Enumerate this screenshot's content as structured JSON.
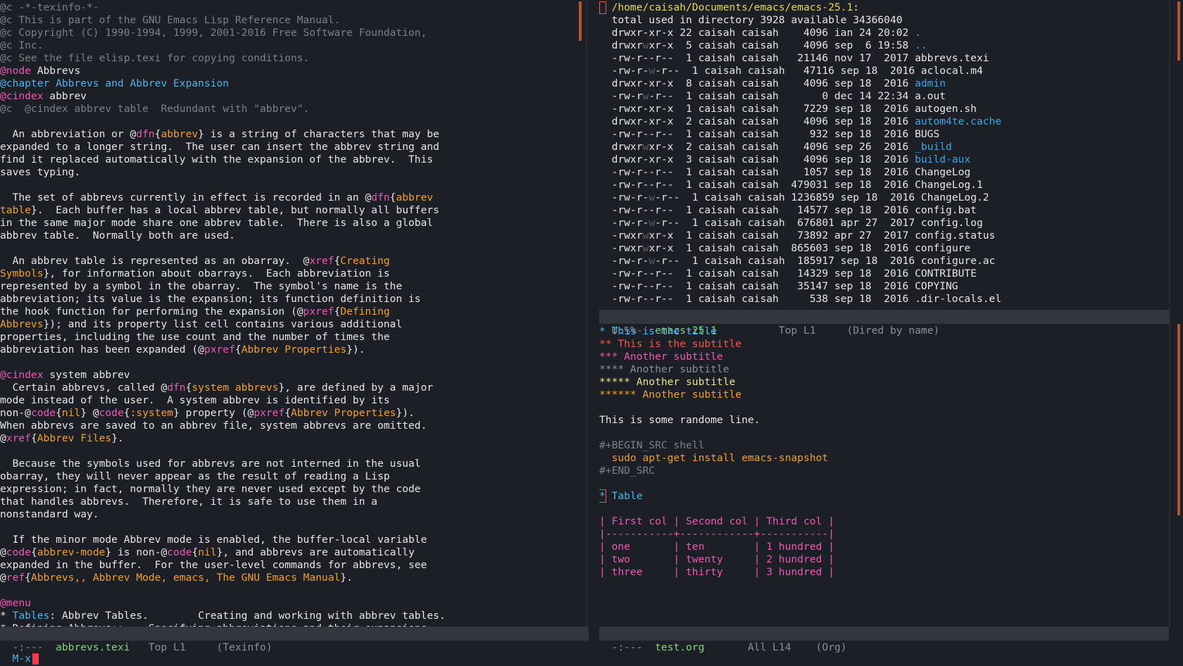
{
  "left": {
    "lines": [
      [
        [
          "@c",
          "c-comment"
        ],
        [
          " -*-texinfo-*-",
          "c-comment"
        ]
      ],
      [
        [
          "@c This is part of the GNU Emacs Lisp Reference Manual.",
          "c-comment"
        ]
      ],
      [
        [
          "@c Copyright (C) 1990-1994, 1999, 2001-2016 Free Software Foundation,",
          "c-comment"
        ]
      ],
      [
        [
          "@c Inc.",
          "c-comment"
        ]
      ],
      [
        [
          "@c See the file elisp.texi for copying conditions.",
          "c-comment"
        ]
      ],
      [
        [
          "@node",
          "c-kw"
        ],
        [
          " Abbrevs",
          "c-plain"
        ]
      ],
      [
        [
          "@chapter Abbrevs and Abbrev Expansion",
          "c-link"
        ]
      ],
      [
        [
          "@cindex",
          "c-kw"
        ],
        [
          " abbrev",
          "c-plain"
        ]
      ],
      [
        [
          "@c  @cindex abbrev table  Redundant with \"abbrev\".",
          "c-comment"
        ]
      ],
      [
        [
          "",
          ""
        ]
      ],
      [
        [
          "  An abbreviation or @",
          "c-plain"
        ],
        [
          "dfn",
          "c-kw"
        ],
        [
          "{",
          "c-plain"
        ],
        [
          "abbrev",
          "c-arg"
        ],
        [
          "} is a string of characters that may be",
          "c-plain"
        ]
      ],
      [
        [
          "expanded to a longer string.  The user can insert the abbrev string and",
          "c-plain"
        ]
      ],
      [
        [
          "find it replaced automatically with the expansion of the abbrev.  This",
          "c-plain"
        ]
      ],
      [
        [
          "saves typing.",
          "c-plain"
        ]
      ],
      [
        [
          "",
          ""
        ]
      ],
      [
        [
          "  The set of abbrevs currently in effect is recorded in an @",
          "c-plain"
        ],
        [
          "dfn",
          "c-kw"
        ],
        [
          "{",
          "c-plain"
        ],
        [
          "abbrev",
          "c-arg"
        ]
      ],
      [
        [
          "table",
          "c-arg"
        ],
        [
          "}.  Each buffer has a local abbrev table, but normally all buffers",
          "c-plain"
        ]
      ],
      [
        [
          "in the same major mode share one abbrev table.  There is also a global",
          "c-plain"
        ]
      ],
      [
        [
          "abbrev table.  Normally both are used.",
          "c-plain"
        ]
      ],
      [
        [
          "",
          ""
        ]
      ],
      [
        [
          "  An abbrev table is represented as an obarray.  @",
          "c-plain"
        ],
        [
          "xref",
          "c-kw"
        ],
        [
          "{",
          "c-plain"
        ],
        [
          "Creating",
          "c-arg"
        ]
      ],
      [
        [
          "Symbols",
          "c-arg"
        ],
        [
          "}, for information about obarrays.  Each abbreviation is",
          "c-plain"
        ]
      ],
      [
        [
          "represented by a symbol in the obarray.  The symbol's name is the",
          "c-plain"
        ]
      ],
      [
        [
          "abbreviation; its value is the expansion; its function definition is",
          "c-plain"
        ]
      ],
      [
        [
          "the hook function for performing the expansion (@",
          "c-plain"
        ],
        [
          "pxref",
          "c-kw"
        ],
        [
          "{",
          "c-plain"
        ],
        [
          "Defining",
          "c-arg"
        ]
      ],
      [
        [
          "Abbrevs",
          "c-arg"
        ],
        [
          "}); and its property list cell contains various additional",
          "c-plain"
        ]
      ],
      [
        [
          "properties, including the use count and the number of times the",
          "c-plain"
        ]
      ],
      [
        [
          "abbreviation has been expanded (@",
          "c-plain"
        ],
        [
          "pxref",
          "c-kw"
        ],
        [
          "{",
          "c-plain"
        ],
        [
          "Abbrev Properties",
          "c-arg"
        ],
        [
          "}).",
          "c-plain"
        ]
      ],
      [
        [
          "",
          ""
        ]
      ],
      [
        [
          "@cindex",
          "c-kw"
        ],
        [
          " system abbrev",
          "c-plain"
        ]
      ],
      [
        [
          "  Certain abbrevs, called @",
          "c-plain"
        ],
        [
          "dfn",
          "c-kw"
        ],
        [
          "{",
          "c-plain"
        ],
        [
          "system abbrevs",
          "c-arg"
        ],
        [
          "}, are defined by a major",
          "c-plain"
        ]
      ],
      [
        [
          "mode instead of the user.  A system abbrev is identified by its",
          "c-plain"
        ]
      ],
      [
        [
          "non-@",
          "c-plain"
        ],
        [
          "code",
          "c-kw"
        ],
        [
          "{",
          "c-plain"
        ],
        [
          "nil",
          "c-arg"
        ],
        [
          "} @",
          "c-plain"
        ],
        [
          "code",
          "c-kw"
        ],
        [
          "{",
          "c-plain"
        ],
        [
          ":system",
          "c-arg"
        ],
        [
          "} property (@",
          "c-plain"
        ],
        [
          "pxref",
          "c-kw"
        ],
        [
          "{",
          "c-plain"
        ],
        [
          "Abbrev Properties",
          "c-arg"
        ],
        [
          "}).",
          "c-plain"
        ]
      ],
      [
        [
          "When abbrevs are saved to an abbrev file, system abbrevs are omitted.",
          "c-plain"
        ]
      ],
      [
        [
          "@",
          "c-plain"
        ],
        [
          "xref",
          "c-kw"
        ],
        [
          "{",
          "c-plain"
        ],
        [
          "Abbrev Files",
          "c-arg"
        ],
        [
          "}.",
          "c-plain"
        ]
      ],
      [
        [
          "",
          ""
        ]
      ],
      [
        [
          "  Because the symbols used for abbrevs are not interned in the usual",
          "c-plain"
        ]
      ],
      [
        [
          "obarray, they will never appear as the result of reading a Lisp",
          "c-plain"
        ]
      ],
      [
        [
          "expression; in fact, normally they are never used except by the code",
          "c-plain"
        ]
      ],
      [
        [
          "that handles abbrevs.  Therefore, it is safe to use them in a",
          "c-plain"
        ]
      ],
      [
        [
          "nonstandard way.",
          "c-plain"
        ]
      ],
      [
        [
          "",
          ""
        ]
      ],
      [
        [
          "  If the minor mode Abbrev mode is enabled, the buffer-local variable",
          "c-plain"
        ]
      ],
      [
        [
          "@",
          "c-plain"
        ],
        [
          "code",
          "c-kw"
        ],
        [
          "{",
          "c-plain"
        ],
        [
          "abbrev-mode",
          "c-arg"
        ],
        [
          "} is non-@",
          "c-plain"
        ],
        [
          "code",
          "c-kw"
        ],
        [
          "{",
          "c-plain"
        ],
        [
          "nil",
          "c-arg"
        ],
        [
          "}, and abbrevs are automatically",
          "c-plain"
        ]
      ],
      [
        [
          "expanded in the buffer.  For the user-level commands for abbrevs, see",
          "c-plain"
        ]
      ],
      [
        [
          "@",
          "c-plain"
        ],
        [
          "ref",
          "c-kw"
        ],
        [
          "{",
          "c-plain"
        ],
        [
          "Abbrevs,, Abbrev Mode, emacs, The GNU Emacs Manual",
          "c-arg"
        ],
        [
          "}.",
          "c-plain"
        ]
      ],
      [
        [
          "",
          ""
        ]
      ],
      [
        [
          "@menu",
          "c-kw"
        ]
      ],
      [
        [
          "* ",
          "c-plain"
        ],
        [
          "Tables",
          "c-link"
        ],
        [
          ": Abbrev Tables.        Creating and working with abbrev tables.",
          "c-plain"
        ]
      ],
      [
        [
          "* Defining Abbrevs::    Specifying abbreviations and their expansions.",
          "c-plain"
        ]
      ]
    ],
    "modeline": {
      "flags": "-:---  ",
      "buffer": "abbrevs.texi",
      "pos": "   Top L1     ",
      "mode": "(Texinfo)"
    }
  },
  "dired": {
    "lines": [
      [
        [
          "  ",
          "c-plain"
        ],
        [
          "/home/caisah/Documents/emacs/emacs-25.1",
          "c-yellow"
        ],
        [
          ":",
          "c-plain"
        ]
      ],
      [
        [
          "  total used in directory 3928 available 34366040",
          "c-plain"
        ]
      ],
      [
        [
          "  drwxr-xr-x 22 caisah caisah    4096 ian 24 20:02 ",
          "c-plain"
        ],
        [
          ".",
          "c-dir"
        ]
      ],
      [
        [
          "  drwxr",
          "c-plain"
        ],
        [
          "w",
          "c-ws"
        ],
        [
          "xr-x  5 caisah caisah    4096 sep  6 19:58 ",
          "c-plain"
        ],
        [
          "..",
          "c-dir"
        ]
      ],
      [
        [
          "  -rw-r--r--  1 caisah caisah   21146 nov 17  2017 abbrevs.texi",
          "c-plain"
        ]
      ],
      [
        [
          "  -rw-r-",
          "c-plain"
        ],
        [
          "w",
          "c-ws"
        ],
        [
          "-r--  1 caisah caisah   47116 sep 18  2016 aclocal.m4",
          "c-plain"
        ]
      ],
      [
        [
          "  drwxr-xr-x  8 caisah caisah    4096 sep 18  2016 ",
          "c-plain"
        ],
        [
          "admin",
          "c-dir"
        ]
      ],
      [
        [
          "  -rw-r",
          "c-plain"
        ],
        [
          "w",
          "c-ws"
        ],
        [
          "-r--  1 caisah caisah       0 dec 14 22:34 a.out",
          "c-plain"
        ]
      ],
      [
        [
          "  -rwxr-xr-x  1 caisah caisah    7229 sep 18  2016 autogen.sh",
          "c-plain"
        ]
      ],
      [
        [
          "  drwxr-xr-x  2 caisah caisah    4096 sep 18  2016 ",
          "c-plain"
        ],
        [
          "autom4te.cache",
          "c-dir"
        ]
      ],
      [
        [
          "  -rw-r--r--  1 caisah caisah     932 sep 18  2016 BUGS",
          "c-plain"
        ]
      ],
      [
        [
          "  drwxr",
          "c-plain"
        ],
        [
          "w",
          "c-ws"
        ],
        [
          "xr-x  2 caisah caisah    4096 sep 26  2016 ",
          "c-plain"
        ],
        [
          "_build",
          "c-dir"
        ]
      ],
      [
        [
          "  drwxr-xr-x  3 caisah caisah    4096 sep 18  2016 ",
          "c-plain"
        ],
        [
          "build-aux",
          "c-dir"
        ]
      ],
      [
        [
          "  -rw-r--r--  1 caisah caisah    1057 sep 18  2016 ChangeLog",
          "c-plain"
        ]
      ],
      [
        [
          "  -rw-r--r--  1 caisah caisah  479031 sep 18  2016 ChangeLog.1",
          "c-plain"
        ]
      ],
      [
        [
          "  -rw-r-",
          "c-plain"
        ],
        [
          "w",
          "c-ws"
        ],
        [
          "-r--  1 caisah caisah 1236859 sep 18  2016 ChangeLog.2",
          "c-plain"
        ]
      ],
      [
        [
          "  -rw-r--r--  1 caisah caisah   14577 sep 18  2016 config.bat",
          "c-plain"
        ]
      ],
      [
        [
          "  -rw-r-",
          "c-plain"
        ],
        [
          "w",
          "c-ws"
        ],
        [
          "-r--  1 caisah caisah  676801 apr 27  2017 config.log",
          "c-plain"
        ]
      ],
      [
        [
          "  -rwxr",
          "c-plain"
        ],
        [
          "w",
          "c-ws"
        ],
        [
          "xr-x  1 caisah caisah   73892 apr 27  2017 config.status",
          "c-plain"
        ]
      ],
      [
        [
          "  -rwxr",
          "c-plain"
        ],
        [
          "w",
          "c-ws"
        ],
        [
          "xr-x  1 caisah caisah  865603 sep 18  2016 configure",
          "c-plain"
        ]
      ],
      [
        [
          "  -rw-r-",
          "c-plain"
        ],
        [
          "w",
          "c-ws"
        ],
        [
          "-r--  1 caisah caisah  185917 sep 18  2016 configure.ac",
          "c-plain"
        ]
      ],
      [
        [
          "  -rw-r--r--  1 caisah caisah   14329 sep 18  2016 CONTRIBUTE",
          "c-plain"
        ]
      ],
      [
        [
          "  -rw-r--r--  1 caisah caisah   35147 sep 18  2016 COPYING",
          "c-plain"
        ]
      ],
      [
        [
          "  -rw-r--r--  1 caisah caisah     538 sep 18  2016 .dir-locals.el",
          "c-plain"
        ]
      ]
    ],
    "modeline": {
      "flags": "U:%%-  ",
      "buffer": "emacs-25.1",
      "pos": "          Top L1     ",
      "mode": "(Dired by name)"
    }
  },
  "org": {
    "lines": [
      [
        [
          "* This is the title",
          "c-h1"
        ]
      ],
      [
        [
          "** This is the subtitle",
          "c-h2"
        ]
      ],
      [
        [
          "*** Another subtitle",
          "c-h3"
        ]
      ],
      [
        [
          "**** Another subtitle",
          "c-h4"
        ]
      ],
      [
        [
          "***** Another subtitle",
          "c-h5"
        ]
      ],
      [
        [
          "****** Another subtitle",
          "c-h6"
        ]
      ],
      [
        [
          "",
          ""
        ]
      ],
      [
        [
          "This is some randome line.",
          "c-plain"
        ]
      ],
      [
        [
          "",
          ""
        ]
      ],
      [
        [
          "#+BEGIN_SRC shell",
          "c-comment"
        ]
      ],
      [
        [
          "  sudo apt-get install emacs-snapshot",
          "c-src"
        ]
      ],
      [
        [
          "#+END_SRC",
          "c-comment"
        ]
      ],
      [
        [
          "",
          ""
        ]
      ],
      [
        [
          "*",
          "c-h1 c-cursor"
        ],
        [
          " Table",
          "c-h1"
        ]
      ],
      [
        [
          "",
          ""
        ]
      ],
      [
        [
          "| First col | Second col | Third col |",
          "c-tbl"
        ]
      ],
      [
        [
          "|-----------+------------+-----------|",
          "c-tbl"
        ]
      ],
      [
        [
          "| one       | ten        | 1 hundred |",
          "c-tbl"
        ]
      ],
      [
        [
          "| two       | twenty     | 2 hundred |",
          "c-tbl"
        ]
      ],
      [
        [
          "| three     | thirty     | 3 hundred |",
          "c-tbl"
        ]
      ]
    ],
    "modeline": {
      "flags": "-:---  ",
      "buffer": "test.org",
      "pos": "       All L14    ",
      "mode": "(Org)"
    }
  },
  "minibuffer": {
    "prompt": "M-x"
  }
}
